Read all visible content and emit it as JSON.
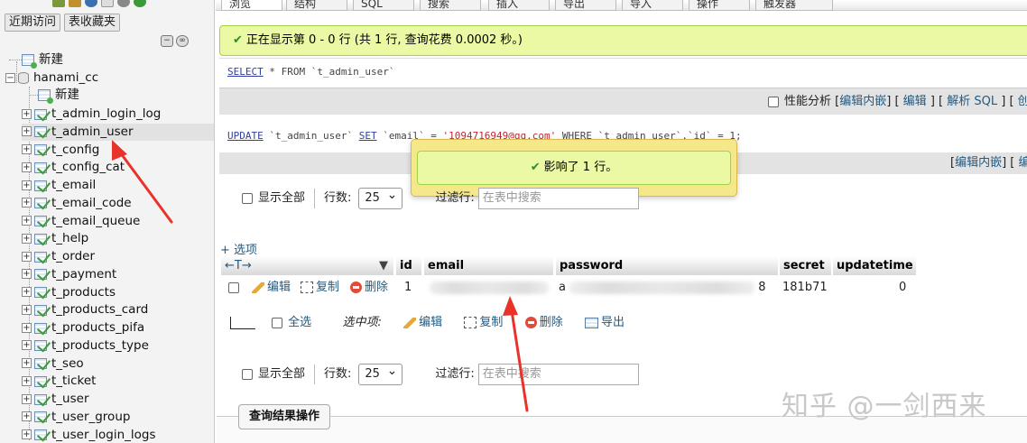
{
  "nav": {
    "recent_label": "近期访问",
    "favorites_label": "表收藏夹",
    "root_new": "新建",
    "database": "hanami_cc",
    "db_new": "新建",
    "tables": [
      "t_admin_login_log",
      "t_admin_user",
      "t_config",
      "t_config_cat",
      "t_email",
      "t_email_code",
      "t_email_queue",
      "t_help",
      "t_order",
      "t_payment",
      "t_products",
      "t_products_card",
      "t_products_pifa",
      "t_products_type",
      "t_seo",
      "t_ticket",
      "t_user",
      "t_user_group",
      "t_user_login_logs"
    ],
    "selected_table": "t_admin_user"
  },
  "top_tabs": [
    "浏览",
    "结构",
    "SQL",
    "搜索",
    "插入",
    "导出",
    "导入",
    "操作",
    "触发器"
  ],
  "success": {
    "message": "正在显示第 0 - 0 行 (共 1 行, 查询花费 0.0002 秒。)"
  },
  "sql1": {
    "kw1": "SELECT",
    "rest": " * FROM `t_admin_user`"
  },
  "sql1_actions": {
    "profiling": "性能分析",
    "edit_inline": "编辑内嵌",
    "edit": "编辑",
    "explain": "解析 SQL",
    "create": "创"
  },
  "sql2": {
    "kw1": "UPDATE",
    "part1": " `t_admin_user` ",
    "kw2": "SET",
    "part2": " `email` = ",
    "value": "'1094716949@qq.com'",
    "part3": " WHERE `t_admin_user`.`id` = 1;"
  },
  "sql2_actions": {
    "edit_inline": "编辑内嵌",
    "edit": "编"
  },
  "popup": {
    "message": "影响了 1 行。"
  },
  "controls": {
    "show_all": "显示全部",
    "rows_label": "行数:",
    "rows_value": "25",
    "filter_label": "过滤行:",
    "filter_placeholder": "在表中搜索"
  },
  "options_link": "+ 选项",
  "table": {
    "columns": [
      "id",
      "email",
      "password",
      "secret",
      "updatetime"
    ],
    "row": {
      "edit": "编辑",
      "copy": "复制",
      "delete": "删除",
      "id": "1",
      "password_prefix": "a",
      "password_suffix": "8",
      "secret": "181b71",
      "updatetime": "0"
    }
  },
  "bulk": {
    "select_all": "全选",
    "selected_label": "选中项:",
    "edit": "编辑",
    "copy": "复制",
    "delete": "删除",
    "export": "导出"
  },
  "query_ops": "查询结果操作",
  "watermark": "知乎 @一剑西来",
  "colors": {
    "success_bg": "#ebf8a4",
    "success_border": "#a2d246",
    "popup_bg": "#f4e88a",
    "link": "#235a81",
    "sql_keyword": "#303fa1",
    "sql_string": "#c1272d",
    "annotation": "#e8322a"
  }
}
